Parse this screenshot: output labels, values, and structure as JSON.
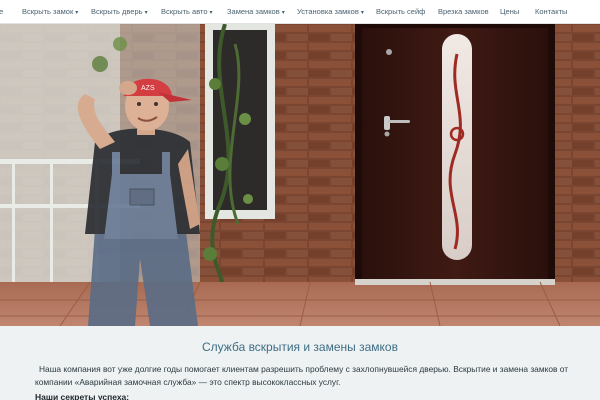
{
  "nav": {
    "items": [
      {
        "label": "е",
        "has_dropdown": false
      },
      {
        "label": "Вскрыть замок",
        "has_dropdown": true
      },
      {
        "label": "Вскрыть дверь",
        "has_dropdown": true
      },
      {
        "label": "Вскрыть авто",
        "has_dropdown": true
      },
      {
        "label": "Замена замков",
        "has_dropdown": true
      },
      {
        "label": "Установка замков",
        "has_dropdown": true
      },
      {
        "label": "Вскрыть сейф",
        "has_dropdown": false
      },
      {
        "label": "Врезка замков",
        "has_dropdown": false
      },
      {
        "label": "Цены",
        "has_dropdown": false
      },
      {
        "label": "Контакты",
        "has_dropdown": false
      }
    ],
    "caret": "▾"
  },
  "hero": {
    "cap_text": "AZS"
  },
  "main": {
    "title": "Служба вскрытия и замены замков",
    "intro": "Наша компания вот уже долгие годы помогает клиентам разрешить проблему с захлопнувшейся дверью. Вскрытие и замена замков от компании «Аварийная замочная служба» — это спектр высококлассных услуг.",
    "secrets_heading": "Наши секреты успеха:"
  },
  "colors": {
    "nav_text": "#4b6270",
    "title": "#3f6d84",
    "content_bg": "#eef2f3",
    "door": "#3a1712",
    "brick": "#7a4632"
  }
}
